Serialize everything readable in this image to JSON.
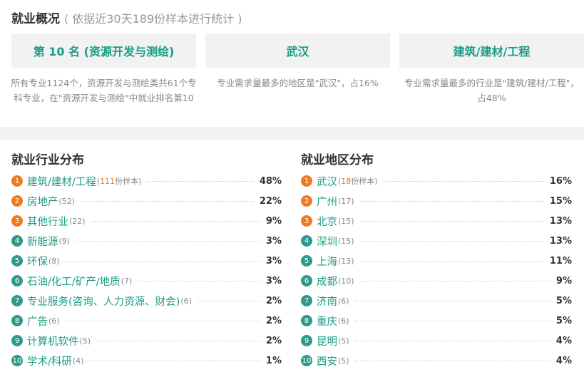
{
  "overview": {
    "title": "就业概况",
    "subtitle": "( 依据近30天189份样本进行统计 )",
    "cards": [
      {
        "label": "第 10 名 (资源开发与测绘)",
        "desc": "所有专业1124个，资源开发与测绘类共61个专科专业，在\"资源开发与测绘\"中就业排名第10"
      },
      {
        "label": "武汉",
        "desc": "专业需求量最多的地区是\"武汉\"，占16%"
      },
      {
        "label": "建筑/建材/工程",
        "desc": "专业需求量最多的行业是\"建筑/建材/工程\"，占48%"
      }
    ]
  },
  "industry": {
    "title": "就业行业分布",
    "items": [
      {
        "rank": "1",
        "name": "建筑/建材/工程",
        "count": "111",
        "suffix": "份样本",
        "pct": "48%"
      },
      {
        "rank": "2",
        "name": "房地产",
        "count": "(52)",
        "pct": "22%"
      },
      {
        "rank": "3",
        "name": "其他行业",
        "count": "(22)",
        "pct": "9%"
      },
      {
        "rank": "4",
        "name": "新能源",
        "count": "(9)",
        "pct": "3%"
      },
      {
        "rank": "5",
        "name": "环保",
        "count": "(8)",
        "pct": "3%"
      },
      {
        "rank": "6",
        "name": "石油/化工/矿产/地质",
        "count": "(7)",
        "pct": "3%"
      },
      {
        "rank": "7",
        "name": "专业服务(咨询、人力资源、财会)",
        "count": "(6)",
        "pct": "2%"
      },
      {
        "rank": "8",
        "name": "广告",
        "count": "(6)",
        "pct": "2%"
      },
      {
        "rank": "9",
        "name": "计算机软件",
        "count": "(5)",
        "pct": "2%"
      },
      {
        "rank": "10",
        "name": "学术/科研",
        "count": "(4)",
        "pct": "1%"
      }
    ]
  },
  "region": {
    "title": "就业地区分布",
    "items": [
      {
        "rank": "1",
        "name": "武汉",
        "count": "18",
        "suffix": "份样本",
        "pct": "16%"
      },
      {
        "rank": "2",
        "name": "广州",
        "count": "(17)",
        "pct": "15%"
      },
      {
        "rank": "3",
        "name": "北京",
        "count": "(15)",
        "pct": "13%"
      },
      {
        "rank": "4",
        "name": "深圳",
        "count": "(15)",
        "pct": "13%"
      },
      {
        "rank": "5",
        "name": "上海",
        "count": "(13)",
        "pct": "11%"
      },
      {
        "rank": "6",
        "name": "成都",
        "count": "(10)",
        "pct": "9%"
      },
      {
        "rank": "7",
        "name": "济南",
        "count": "(6)",
        "pct": "5%"
      },
      {
        "rank": "8",
        "name": "重庆",
        "count": "(6)",
        "pct": "5%"
      },
      {
        "rank": "9",
        "name": "昆明",
        "count": "(5)",
        "pct": "4%"
      },
      {
        "rank": "10",
        "name": "西安",
        "count": "(5)",
        "pct": "4%"
      }
    ]
  },
  "colors": {
    "accent": "#1b9c85",
    "top_rank": "#f07a1f",
    "rank": "#2f9a8b",
    "card_bg": "#f2f2f2"
  }
}
